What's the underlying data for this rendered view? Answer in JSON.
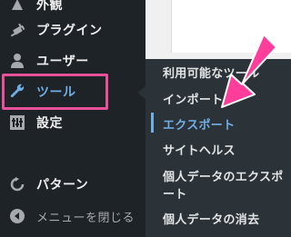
{
  "sidebar": {
    "items": [
      {
        "label": "外観",
        "icon": "appearance-icon"
      },
      {
        "label": "プラグイン",
        "icon": "plugins-icon"
      },
      {
        "label": "ユーザー",
        "icon": "users-icon"
      },
      {
        "label": "ツール",
        "icon": "tools-icon"
      },
      {
        "label": "設定",
        "icon": "settings-icon"
      },
      {
        "label": "パターン",
        "icon": "patterns-icon"
      },
      {
        "label": "メニューを閉じる",
        "icon": "collapse-menu-icon"
      }
    ]
  },
  "submenu": {
    "items": [
      {
        "label": "利用可能なツール"
      },
      {
        "label": "インポート"
      },
      {
        "label": "エクスポート",
        "active": true
      },
      {
        "label": "サイトヘルス"
      },
      {
        "label_line1": "個人データのエクスポ",
        "label_line2": "ート"
      },
      {
        "label": "個人データの消去"
      }
    ]
  },
  "colors": {
    "sidebar_bg": "#1d2327",
    "submenu_bg": "#2c3338",
    "accent": "#72aee6",
    "highlight": "#e8519a",
    "arrow": "#ff3d9a"
  }
}
